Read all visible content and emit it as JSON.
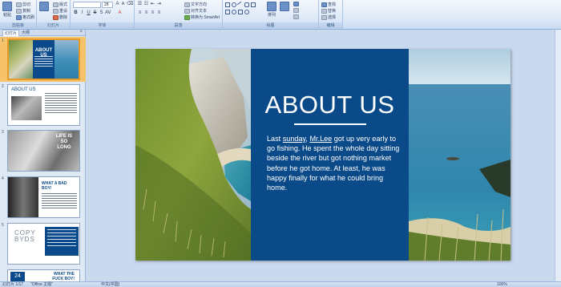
{
  "ribbon": {
    "groups": [
      {
        "label": "剪贴板",
        "buttons": [
          "粘贴",
          "剪切",
          "复制",
          "格式刷"
        ]
      },
      {
        "label": "幻灯片",
        "buttons": [
          "新建幻灯片",
          "版式",
          "重设",
          "删除"
        ]
      },
      {
        "label": "字体",
        "font_name": "",
        "font_size": "28"
      },
      {
        "label": "段落",
        "buttons": [
          "文字方向",
          "对齐文本",
          "转换为 SmartArt"
        ]
      },
      {
        "label": "绘图",
        "buttons": [
          "排列",
          "快速样式",
          "形状填充",
          "形状轮廓",
          "形状效果"
        ]
      },
      {
        "label": "编辑",
        "buttons": [
          "查找",
          "替换",
          "选择"
        ]
      }
    ]
  },
  "panel": {
    "tabs": [
      "幻灯片",
      "大纲"
    ],
    "close": "×",
    "slides": [
      {
        "num": "1",
        "title": "ABOUT US"
      },
      {
        "num": "2",
        "title": "ABOUT US"
      },
      {
        "num": "3",
        "title": "LIFE IS SO LONG"
      },
      {
        "num": "4",
        "title": "WHAT A BAD BOY!"
      },
      {
        "num": "5",
        "title": "COPY BYDS"
      },
      {
        "num": "6",
        "badge": "24",
        "title": "WHAT THE FUCK BOY!"
      }
    ]
  },
  "slide": {
    "title": "ABOUT US",
    "body_before": "Last ",
    "body_u1": "sunday",
    "body_mid": ", ",
    "body_u2": "Mr.Lee",
    "body_after": " got up very early to go fishing. He spent the whole day sitting beside the river but got nothing market before he got home. At least, he was happy finally for what he could bring home.",
    "colors": {
      "panel": "#0b4a88",
      "text": "#ffffff"
    }
  },
  "status": {
    "slide_info": "幻灯片 1/17",
    "theme": "\"Office 主题\"",
    "language": "中文(中国)",
    "zoom": "100%"
  }
}
